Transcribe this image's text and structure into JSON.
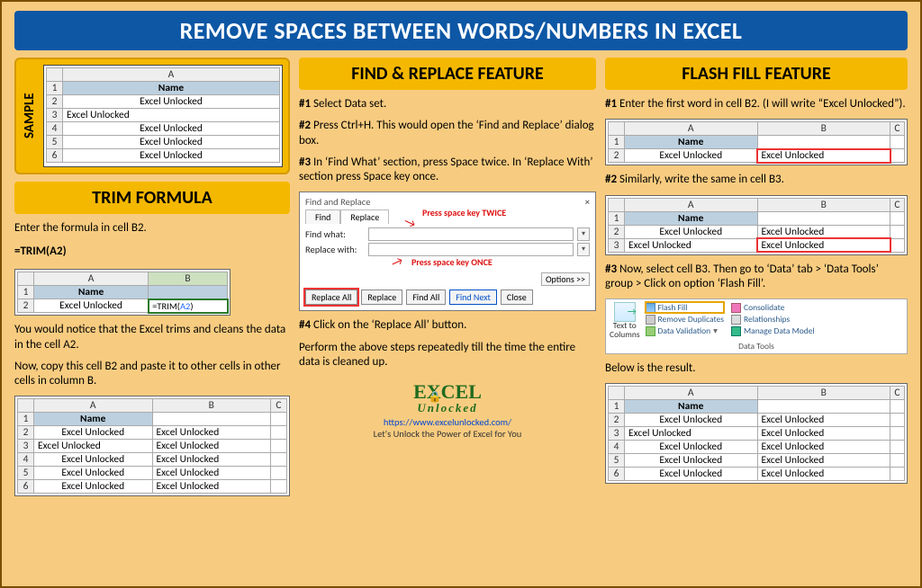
{
  "title": "REMOVE SPACES BETWEEN WORDS/NUMBERS IN EXCEL",
  "sample": {
    "label": "SAMPLE",
    "col": "A",
    "header": "Name",
    "rows": [
      "Excel Unlocked",
      "Excel      Unlocked",
      "Excel Unlocked",
      "Excel   Unlocked",
      "Excel        Unlocked"
    ]
  },
  "trim": {
    "heading": "TRIM FORMULA",
    "p1": "Enter the formula in cell B2.",
    "formula_plain": "=TRIM(",
    "formula_ref": "A2",
    "formula_close": ")",
    "formula_line": "=TRIM(A2)",
    "mini": {
      "cols": [
        "A",
        "B"
      ],
      "header": "Name",
      "row2_a": "Excel Unlocked",
      "row2_b": "=TRIM(A2)"
    },
    "p2": "You would notice that the Excel trims and cleans the data in the cell A2.",
    "p3": "Now, copy this cell B2 and paste it to other cells in other cells in column B.",
    "result": {
      "cols": [
        "A",
        "B",
        "C"
      ],
      "header": "Name",
      "rows": [
        [
          "Excel Unlocked",
          "Excel Unlocked",
          ""
        ],
        [
          "Excel      Unlocked",
          "Excel Unlocked",
          ""
        ],
        [
          "Excel Unlocked",
          "Excel Unlocked",
          ""
        ],
        [
          "Excel   Unlocked",
          "Excel Unlocked",
          ""
        ],
        [
          "Excel        Unlocked",
          "Excel Unlocked",
          ""
        ]
      ]
    }
  },
  "find": {
    "heading": "FIND & REPLACE FEATURE",
    "s1": "Select Data set.",
    "s2": "Press Ctrl+H. This would open the ‘Find and Replace’ dialog box.",
    "s3": "In ‘Find What’ section, press Space twice. In ‘Replace With’ section press Space key once.",
    "s4": "Click on the ‘Replace All’ button.",
    "footer": "Perform the above steps repeatedly till the time the entire data is cleaned up.",
    "dialog": {
      "title": "Find and Replace",
      "tab_find": "Find",
      "tab_replace": "Replace",
      "lbl_find": "Find what:",
      "lbl_replace": "Replace with:",
      "note_twice": "Press space key TWICE",
      "note_once": "Press space key ONCE",
      "options": "Options >>",
      "btn_replace_all": "Replace All",
      "btn_replace": "Replace",
      "btn_find_all": "Find All",
      "btn_find_next": "Find Next",
      "btn_close": "Close"
    }
  },
  "flash": {
    "heading": "FLASH FILL FEATURE",
    "s1": "Enter the first word in cell B2. (I will write “Excel Unlocked”).",
    "grid1": {
      "cols": [
        "A",
        "B",
        "C"
      ],
      "header": "Name",
      "row": [
        "Excel Unlocked",
        "Excel Unlocked"
      ]
    },
    "s2": "Similarly, write the same in cell B3.",
    "grid2": {
      "cols": [
        "A",
        "B",
        "C"
      ],
      "header": "Name",
      "rows": [
        [
          "Excel Unlocked",
          "Excel Unlocked"
        ],
        [
          "Excel      Unlocked",
          "Excel Unlocked"
        ]
      ]
    },
    "s3": "Now, select cell B3. Then go to ‘Data’ tab > ‘Data Tools’ group > Click on option ‘Flash Fill’.",
    "ribbon": {
      "text_to_columns": "Text to Columns",
      "flash_fill": "Flash Fill",
      "remove_dup": "Remove Duplicates",
      "data_val": "Data Validation",
      "consolidate": "Consolidate",
      "relationships": "Relationships",
      "manage": "Manage Data Model",
      "caption": "Data Tools"
    },
    "result_intro": "Below is the result.",
    "result": {
      "cols": [
        "A",
        "B",
        "C"
      ],
      "header": "Name",
      "rows": [
        [
          "Excel Unlocked",
          "Excel Unlocked",
          ""
        ],
        [
          "Excel      Unlocked",
          "Excel Unlocked",
          ""
        ],
        [
          "Excel Unlocked",
          "Excel Unlocked",
          ""
        ],
        [
          "Excel   Unlocked",
          "Excel Unlocked",
          ""
        ],
        [
          "Excel        Unlocked",
          "Excel Unlocked",
          ""
        ]
      ]
    }
  },
  "branding": {
    "logo_top": "EXCEL",
    "logo_sub": "Unlocked",
    "url": "https://www.excelunlocked.com/",
    "tagline": "Let's Unlock the Power of Excel for You"
  }
}
